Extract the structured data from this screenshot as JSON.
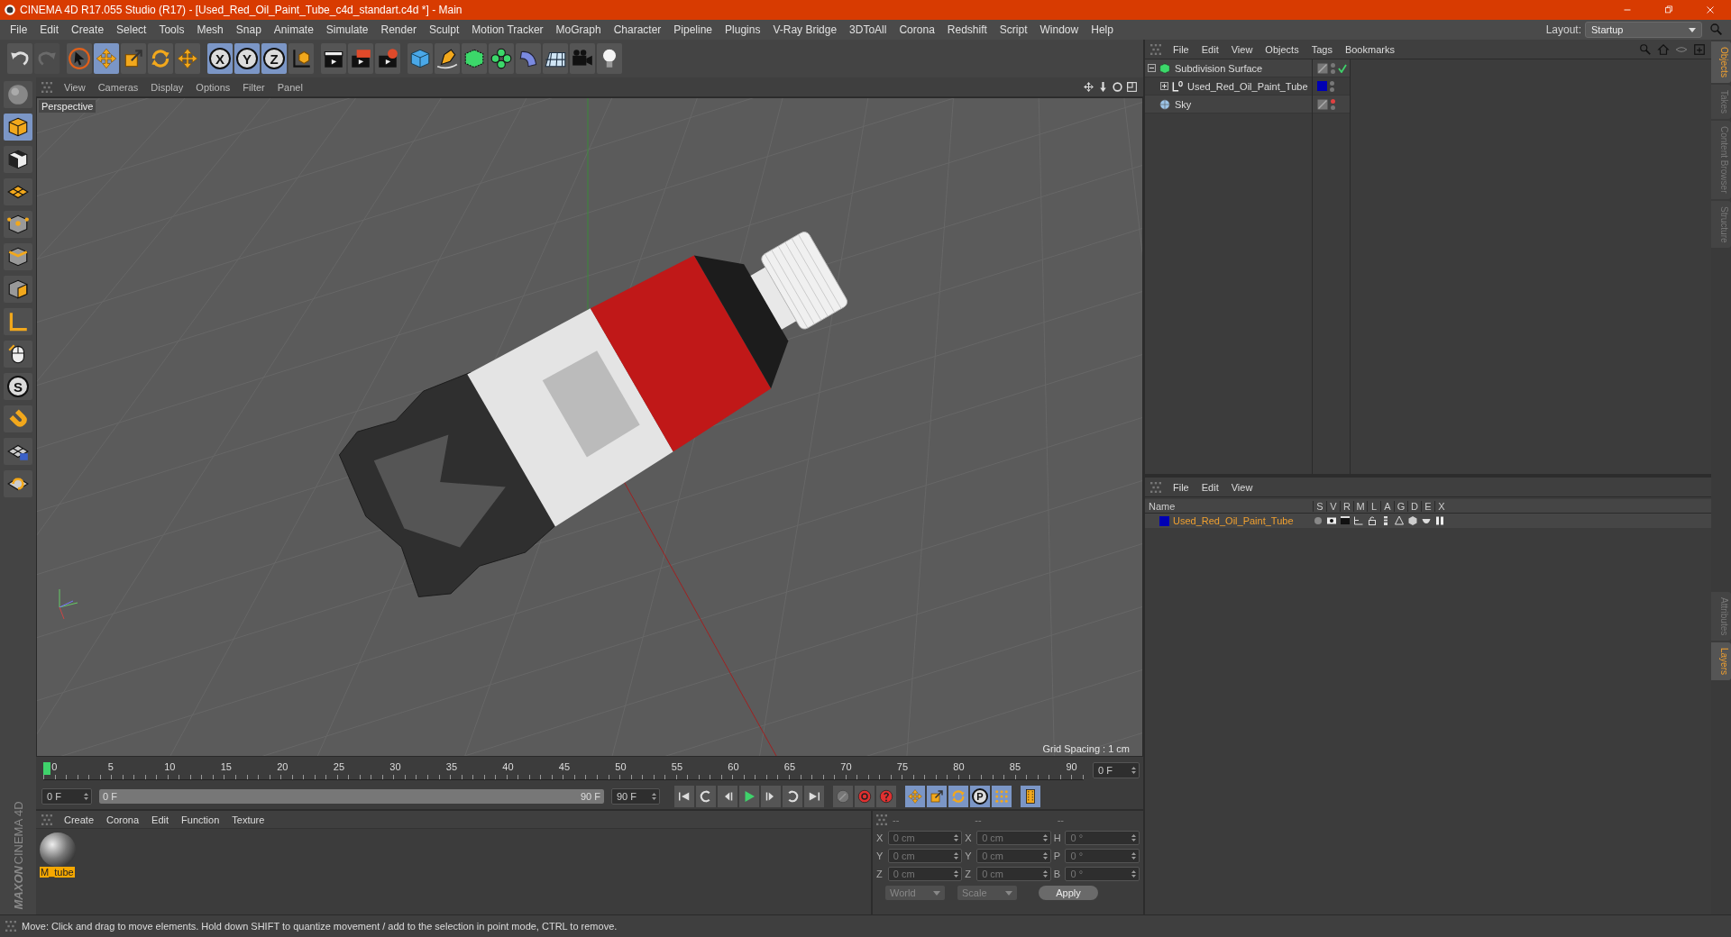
{
  "window": {
    "title": "CINEMA 4D R17.055 Studio (R17) - [Used_Red_Oil_Paint_Tube_c4d_standart.c4d *] - Main"
  },
  "menu": [
    "File",
    "Edit",
    "Create",
    "Select",
    "Tools",
    "Mesh",
    "Snap",
    "Animate",
    "Simulate",
    "Render",
    "Sculpt",
    "Motion Tracker",
    "MoGraph",
    "Character",
    "Pipeline",
    "Plugins",
    "V-Ray Bridge",
    "3DToAll",
    "Corona",
    "Redshift",
    "Script",
    "Window",
    "Help"
  ],
  "layout": {
    "label": "Layout:",
    "value": "Startup"
  },
  "toolbar": [
    {
      "items": [
        {
          "kind": "undo",
          "selected": false,
          "disabled": false
        },
        {
          "kind": "redo",
          "selected": false,
          "disabled": true
        }
      ]
    },
    {
      "items": [
        {
          "kind": "cursor",
          "selected": false,
          "disabled": false
        },
        {
          "kind": "move",
          "selected": true,
          "disabled": false
        },
        {
          "kind": "scale",
          "selected": false,
          "disabled": false
        },
        {
          "kind": "rotate",
          "selected": false,
          "disabled": false
        },
        {
          "kind": "move",
          "selected": false,
          "disabled": false
        }
      ]
    },
    {
      "items": [
        {
          "kind": "axis-letter",
          "label": "X",
          "selected": true,
          "disabled": false
        },
        {
          "kind": "axis-letter",
          "label": "Y",
          "selected": true,
          "disabled": false
        },
        {
          "kind": "axis-letter",
          "label": "Z",
          "selected": true,
          "disabled": false
        },
        {
          "kind": "coords",
          "selected": false,
          "disabled": false
        }
      ]
    },
    {
      "items": [
        {
          "kind": "clapper",
          "selected": false,
          "disabled": false
        },
        {
          "kind": "clapper-play",
          "selected": false,
          "disabled": false
        },
        {
          "kind": "clapper-gear",
          "selected": false,
          "disabled": false
        }
      ]
    },
    {
      "items": [
        {
          "kind": "cube",
          "selected": false,
          "disabled": false
        },
        {
          "kind": "pen",
          "selected": false,
          "disabled": false
        },
        {
          "kind": "green-cube",
          "selected": false,
          "disabled": false
        },
        {
          "kind": "flower",
          "selected": false,
          "disabled": false
        },
        {
          "kind": "bend",
          "selected": false,
          "disabled": false
        },
        {
          "kind": "floor",
          "selected": false,
          "disabled": false
        },
        {
          "kind": "camera",
          "selected": false,
          "disabled": false
        },
        {
          "kind": "bulb",
          "selected": false,
          "disabled": false
        }
      ]
    }
  ],
  "tools": [
    {
      "kind": "sphere-grey",
      "selected": false
    },
    {
      "kind": "cube-orange",
      "selected": true
    },
    {
      "kind": "checker",
      "selected": false
    },
    {
      "kind": "plane",
      "selected": false
    },
    {
      "kind": "points",
      "selected": false
    },
    {
      "kind": "edges",
      "selected": false
    },
    {
      "kind": "polygons",
      "selected": false
    },
    {
      "kind": "angle",
      "selected": false
    },
    {
      "kind": "mouse",
      "selected": false
    },
    {
      "kind": "letter",
      "label": "S",
      "selected": false
    },
    {
      "kind": "magnet",
      "selected": false
    },
    {
      "kind": "lock-grid",
      "selected": false
    },
    {
      "kind": "spiral-grid",
      "selected": false
    }
  ],
  "viewport": {
    "menu": [
      "View",
      "Cameras",
      "Display",
      "Options",
      "Filter",
      "Panel"
    ],
    "label": "Perspective",
    "grid_spacing": "Grid Spacing : 1 cm"
  },
  "timeline": {
    "ticks": [
      "0",
      "5",
      "10",
      "15",
      "20",
      "25",
      "30",
      "35",
      "40",
      "45",
      "50",
      "55",
      "60",
      "65",
      "70",
      "75",
      "80",
      "85",
      "90"
    ],
    "level": 0,
    "current_frame": "0 F"
  },
  "transport": {
    "start": "0 F",
    "range": {
      "start": "0 F",
      "end": "90 F",
      "level": 1
    },
    "end": "90 F",
    "button_groups": [
      {
        "items": [
          {
            "kind": "first"
          },
          {
            "kind": "key-prev"
          },
          {
            "kind": "step-back"
          },
          {
            "kind": "play"
          },
          {
            "kind": "step-fwd"
          },
          {
            "kind": "key-next"
          },
          {
            "kind": "last"
          }
        ]
      },
      {
        "items": [
          {
            "kind": "keyframe"
          },
          {
            "kind": "autokey"
          },
          {
            "kind": "help"
          }
        ]
      },
      {
        "items": [
          {
            "kind": "move",
            "selected": true
          },
          {
            "kind": "scale",
            "selected": true
          },
          {
            "kind": "rotate",
            "selected": true
          },
          {
            "kind": "letter",
            "label": "P",
            "selected": true
          },
          {
            "kind": "dots",
            "selected": true
          }
        ]
      },
      {
        "items": [
          {
            "kind": "film",
            "selected": true
          }
        ]
      }
    ]
  },
  "materials": {
    "menu": [
      "Create",
      "Corona",
      "Edit",
      "Function",
      "Texture"
    ],
    "items": [
      {
        "name": "M_tube",
        "selected": true
      }
    ]
  },
  "coordinates": {
    "headers": [
      "--",
      "--",
      "--"
    ],
    "rows": [
      {
        "axis": "X",
        "position": "0 cm",
        "size_axis": "X",
        "size": "0 cm",
        "rot_axis": "H",
        "rotation": "0 °"
      },
      {
        "axis": "Y",
        "position": "0 cm",
        "size_axis": "Y",
        "size": "0 cm",
        "rot_axis": "P",
        "rotation": "0 °"
      },
      {
        "axis": "Z",
        "position": "0 cm",
        "size_axis": "Z",
        "size": "0 cm",
        "rot_axis": "B",
        "rotation": "0 °"
      }
    ],
    "mode": "World",
    "size_mode": "Scale",
    "apply": "Apply"
  },
  "logo": {
    "brand": "MAXON",
    "product": "CINEMA 4D"
  },
  "objects": {
    "menu": [
      "File",
      "Edit",
      "View",
      "Objects",
      "Tags",
      "Bookmarks"
    ],
    "tree": [
      {
        "name": "Subdivision Surface",
        "kind": "subdivision",
        "expanded": true,
        "editor_visible": true,
        "enabled": true,
        "display_tag": true,
        "children": [
          {
            "name": "Used_Red_Oil_Paint_Tube",
            "kind": "null",
            "expanded": false,
            "editor_visible": true,
            "display_tag": false,
            "color": "#0000b4"
          }
        ]
      },
      {
        "name": "Sky",
        "kind": "sky",
        "editor_visible": false,
        "display_tag": true
      }
    ]
  },
  "layers": {
    "menu": [
      "File",
      "Edit",
      "View"
    ],
    "columns": [
      "Name",
      "S",
      "V",
      "R",
      "M",
      "L",
      "A",
      "G",
      "D",
      "E",
      "X"
    ],
    "rows": [
      {
        "name": "Used_Red_Oil_Paint_Tube",
        "color": "#0000b4"
      }
    ]
  },
  "side_tabs_top": [
    {
      "label": "Objects",
      "selected": true
    },
    {
      "label": "Takes",
      "selected": false
    },
    {
      "label": "Content Browser",
      "selected": false
    },
    {
      "label": "Structure",
      "selected": false
    }
  ],
  "side_tabs_bottom": [
    {
      "label": "Attributes",
      "selected": false
    },
    {
      "label": "Layers",
      "selected": true
    }
  ],
  "status": "Move: Click and drag to move elements. Hold down SHIFT to quantize movement / add to the selection in point mode, CTRL to remove."
}
